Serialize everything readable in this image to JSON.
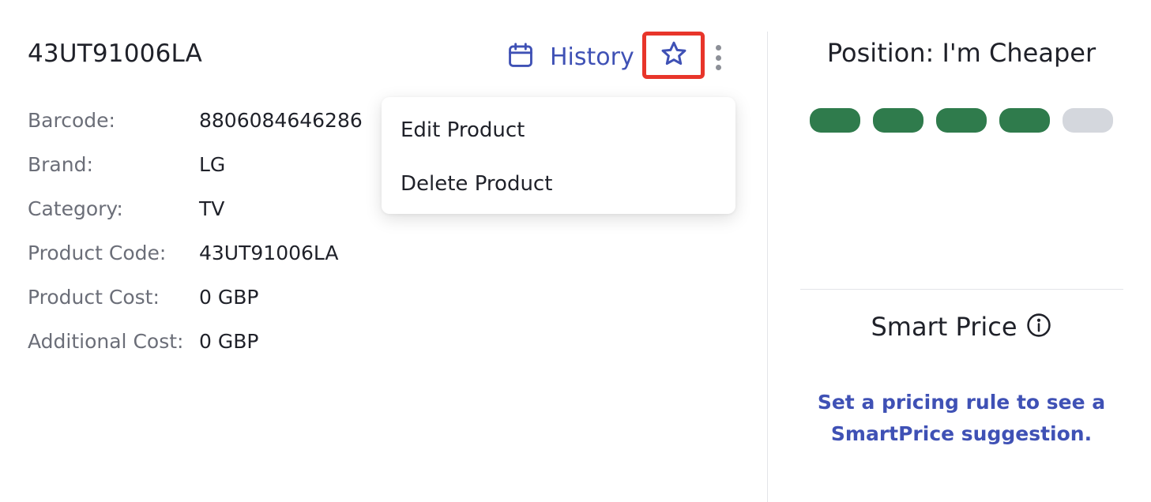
{
  "product": {
    "title": "43UT91006LA",
    "history_label": "History",
    "icons": {
      "calendar": "calendar-icon",
      "star": "star-outline-icon",
      "more": "kebab-menu-icon",
      "info": "info-icon"
    },
    "details": [
      {
        "label": "Barcode:",
        "value": "8806084646286"
      },
      {
        "label": "Brand:",
        "value": "LG"
      },
      {
        "label": "Category:",
        "value": "TV"
      },
      {
        "label": "Product Code:",
        "value": "43UT91006LA"
      },
      {
        "label": "Product Cost:",
        "value": "0 GBP"
      },
      {
        "label": "Additional Cost:",
        "value": "0 GBP"
      }
    ]
  },
  "menu": {
    "items": [
      {
        "label": "Edit Product"
      },
      {
        "label": "Delete Product"
      }
    ]
  },
  "position": {
    "title": "Position: I'm Cheaper",
    "level": 4,
    "max": 5
  },
  "smart_price": {
    "title": "Smart Price",
    "message_line1": "Set a pricing rule to see a",
    "message_line2": "SmartPrice suggestion."
  },
  "colors": {
    "accent": "#3f51b5",
    "highlight": "#e8352a",
    "level_on": "#2f7b4c",
    "level_off": "#d4d7dd"
  }
}
